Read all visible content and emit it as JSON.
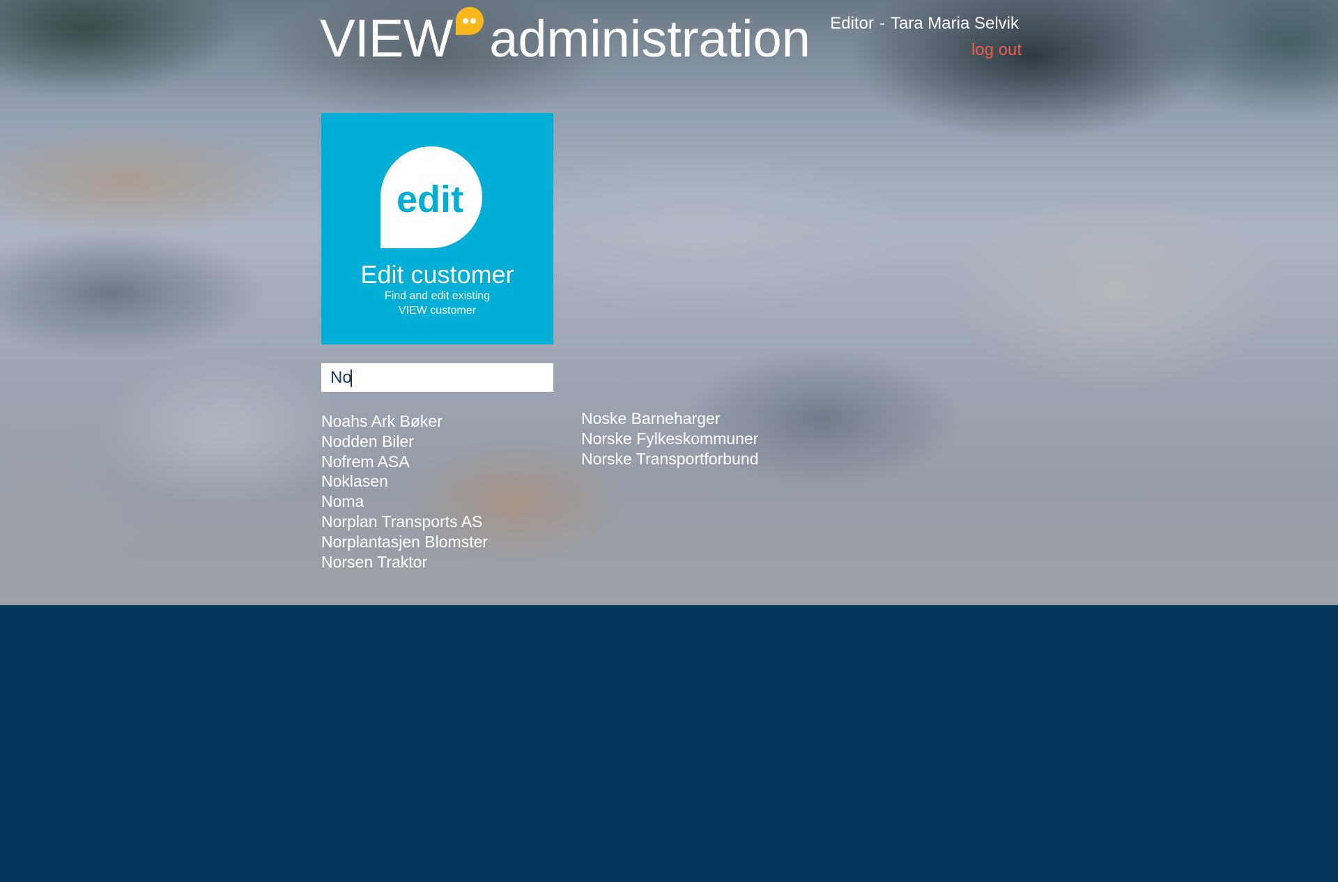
{
  "header": {
    "logo_brand": "VIEW",
    "logo_suffix": "administration",
    "user_role": "Editor",
    "user_separator": "-",
    "user_name": "Tara Maria Selvik",
    "logout_label": "log out"
  },
  "edit_card": {
    "icon_label": "edit",
    "title": "Edit customer",
    "description": "Find and edit existing VIEW customer"
  },
  "search": {
    "value": "No",
    "placeholder": ""
  },
  "results": {
    "column1": [
      "Noahs Ark Bøker",
      "Nodden Biler",
      "Nofrem ASA",
      "Noklasen",
      "Noma",
      "Norplan Transports AS",
      "Norplantasjen Blomster",
      "Norsen Traktor"
    ],
    "column2": [
      "Noske Barneharger",
      "Norske Fylkeskommuner",
      "Norske Transportforbund"
    ]
  },
  "colors": {
    "accent_cyan": "#00aed6",
    "logo_yellow": "#fbb81c",
    "logout_red": "#f15b4a",
    "footer_navy": "#053858"
  },
  "icons": {
    "logo_icon": "speech-bubble-icon",
    "card_icon": "edit-speech-bubble-icon"
  }
}
